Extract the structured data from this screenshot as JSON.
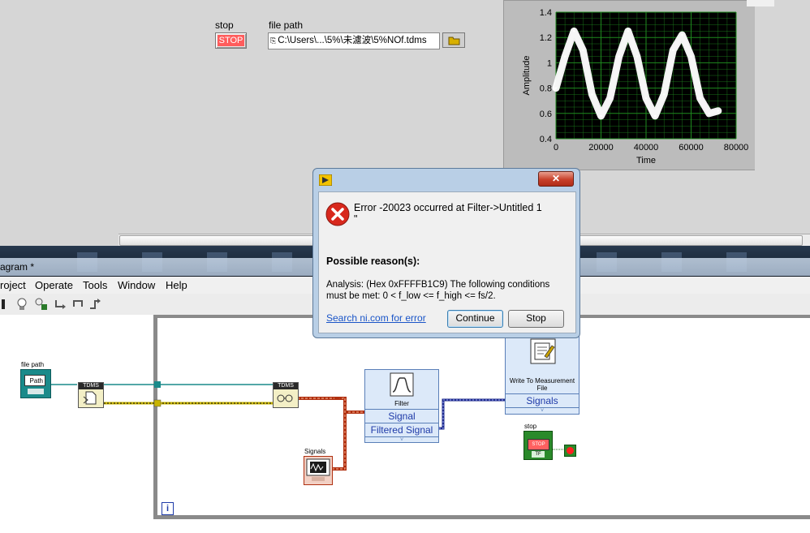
{
  "front_panel": {
    "stop_label": "stop",
    "stop_button": "STOP",
    "file_path_label": "file path",
    "file_path_value": "C:\\Users\\...\\5%\\未濾波\\5%NOf.tdms"
  },
  "graph": {
    "ylabel": "Amplitude",
    "xlabel": "Time",
    "yticks": [
      "1.4",
      "1.2",
      "1",
      "0.8",
      "0.6",
      "0.4"
    ],
    "xticks": [
      "0",
      "20000",
      "40000",
      "60000",
      "80000"
    ]
  },
  "chart_data": {
    "type": "line",
    "title": "",
    "xlabel": "Time",
    "ylabel": "Amplitude",
    "xlim": [
      0,
      80000
    ],
    "ylim": [
      0.4,
      1.4
    ],
    "grid": true,
    "series": [
      {
        "x": [
          0,
          4000,
          8000,
          12000,
          16000,
          20000,
          24000,
          28000,
          32000,
          36000,
          40000,
          44000,
          48000,
          52000,
          56000,
          60000,
          64000,
          68000,
          72000
        ],
        "y": [
          0.8,
          1.05,
          1.25,
          1.1,
          0.75,
          0.58,
          0.72,
          1.05,
          1.25,
          1.05,
          0.72,
          0.58,
          0.75,
          1.1,
          1.22,
          1.05,
          0.72,
          0.6,
          0.62
        ]
      }
    ]
  },
  "block_diagram": {
    "window_title": "agram *",
    "menu": [
      "roject",
      "Operate",
      "Tools",
      "Window",
      "Help"
    ],
    "file_path_node": "file path",
    "path_text": "Path",
    "tdms_open": "TDMS",
    "tdms_read": "TDMS",
    "filter_title": "Filter",
    "filter_in": "Signal",
    "filter_out": "Filtered Signal",
    "signals_node": "Signals",
    "write_title": "Write To Measurement File",
    "write_in": "Signals",
    "stop_node": "stop",
    "stop_text": "STOP",
    "tf_text": "TF",
    "loop_index": "i"
  },
  "dialog": {
    "title_line1": "Error -20023 occurred at Filter->Untitled 1",
    "title_line2": "\"",
    "reasons_heading": "Possible reason(s):",
    "reason_line1": "Analysis: (Hex 0xFFFFB1C9) The following conditions",
    "reason_line2": "must be met:  0 < f_low <= f_high <= fs/2.",
    "search_link": "Search ni.com for error",
    "continue_button": "Continue",
    "stop_button": "Stop"
  },
  "colors": {
    "error_red": "#d8281d",
    "graph_bg": "#000000",
    "grid": "#1f8a1f",
    "wire_signal": "#1e2a8a",
    "wire_dynamic": "#b03010",
    "wire_path": "#1a8a8a",
    "wire_refnum": "#c8b400"
  }
}
